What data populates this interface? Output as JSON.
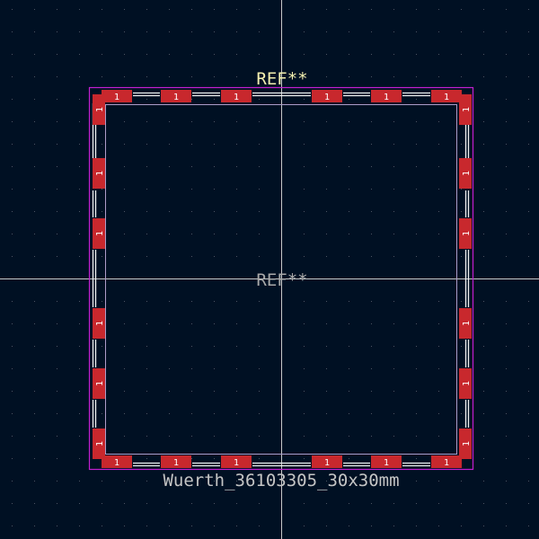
{
  "footprint": {
    "ref_top": "REF**",
    "ref_center": "REF**",
    "value": "Wuerth_36103305_30x30mm",
    "pad_number": "1"
  },
  "colors": {
    "background": "#001023",
    "grid": "#4b5563",
    "crosshair": "#c8c8c8",
    "courtyard": "#c21fd0",
    "silkscreen": "#f2f2f2",
    "fab": "#ad9cc9",
    "pad": "#c8282d",
    "pad_text": "#ffffff",
    "ref_top_color": "#f4f0b0",
    "ref_center_color": "#a9a9a9",
    "value_color": "#c5c5c5"
  }
}
